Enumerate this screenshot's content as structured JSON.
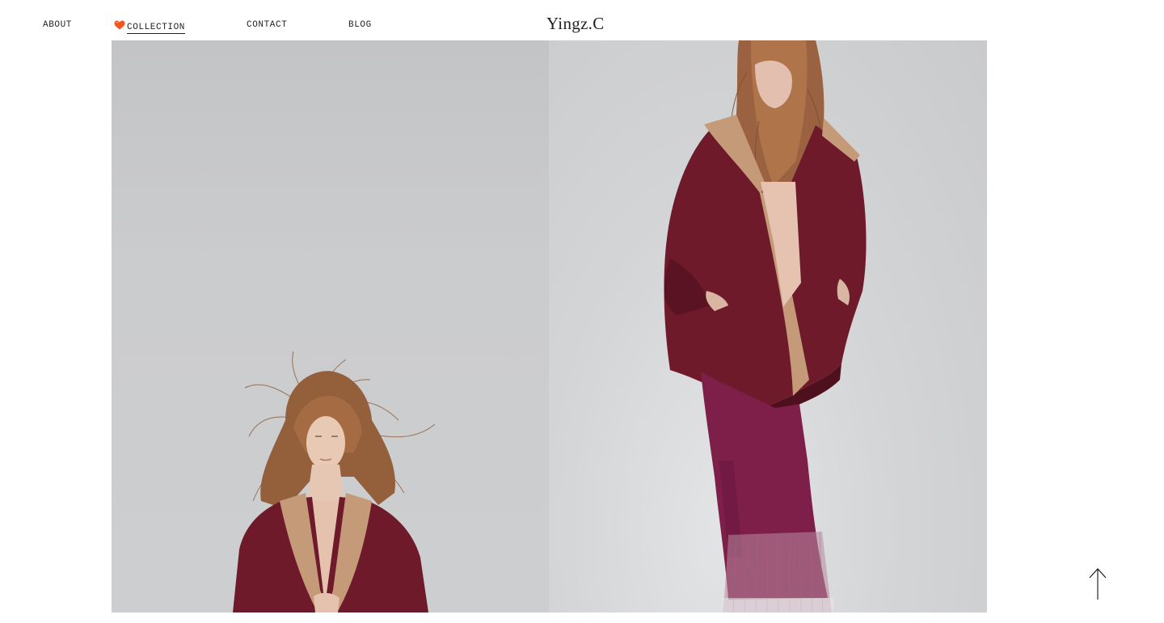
{
  "nav": {
    "about": "ABOUT",
    "collection": "COLLECTION",
    "contact": "CONTACT",
    "blog": "BLOG",
    "active": "collection"
  },
  "brand": {
    "name": "Yingz.C"
  },
  "gallery": {
    "photos": [
      {
        "alt": "model in burgundy coat with camel lining, hair blowing"
      },
      {
        "alt": "model in burgundy coat with plum pleated skirt"
      }
    ]
  },
  "icons": {
    "active_marker": "heart-icon",
    "back_to_top": "arrow-up-icon"
  },
  "colors": {
    "text": "#222222",
    "heart": "#f4561e",
    "coat": "#6e1a2a",
    "lining": "#c49a78",
    "skirt": "#7e1f4a"
  }
}
